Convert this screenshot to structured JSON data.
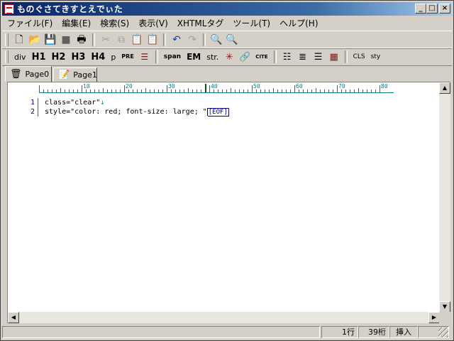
{
  "window": {
    "title": "ものぐさてきすとえでぃた",
    "min_label": "_",
    "max_label": "□",
    "close_label": "×"
  },
  "menu": [
    "ファイル(F)",
    "編集(E)",
    "検索(S)",
    "表示(V)",
    "XHTMLタグ",
    "ツール(T)",
    "ヘルプ(H)"
  ],
  "toolbar1": [
    {
      "name": "new-file-icon",
      "glyph": "🗋"
    },
    {
      "name": "open-folder-icon",
      "glyph": "📂"
    },
    {
      "name": "save-icon",
      "glyph": "💾"
    },
    {
      "name": "close-file-icon",
      "glyph": "■"
    },
    {
      "name": "print-icon",
      "glyph": "🖶"
    },
    {
      "name": "cut-icon",
      "glyph": "✂"
    },
    {
      "name": "copy-icon",
      "glyph": "⧉"
    },
    {
      "name": "paste-icon",
      "glyph": "📋"
    },
    {
      "name": "paste-special-icon",
      "glyph": "📋"
    },
    {
      "name": "undo-icon",
      "glyph": "↶"
    },
    {
      "name": "redo-icon",
      "glyph": "↷"
    },
    {
      "name": "search-icon",
      "glyph": "🔍"
    },
    {
      "name": "replace-icon",
      "glyph": "🔍"
    }
  ],
  "toolbar2": {
    "div": "div",
    "h1": "H1",
    "h2": "H2",
    "h3": "H3",
    "h4": "H4",
    "p": "p",
    "pre": "PRE",
    "span": "span",
    "em": "EM",
    "strong": "str.",
    "cite": "CITE",
    "cls": "CLS",
    "sty": "sty"
  },
  "tabs": [
    {
      "label": "Page0",
      "icon": "trash-icon"
    },
    {
      "label": "Page1",
      "icon": "edit-page-icon"
    }
  ],
  "ruler": {
    "marks": [
      "10",
      "20",
      "30",
      "40",
      "50",
      "60",
      "70",
      "80"
    ]
  },
  "editor": {
    "line_numbers": [
      "1",
      "2"
    ],
    "line1": "class=\"clear\"",
    "newline_mark": "↓",
    "line2": "style=\"color: red; font-size: large; \"",
    "eof": "[EOF]"
  },
  "status": {
    "line": "1行",
    "column": "39桁",
    "mode": "挿入"
  }
}
